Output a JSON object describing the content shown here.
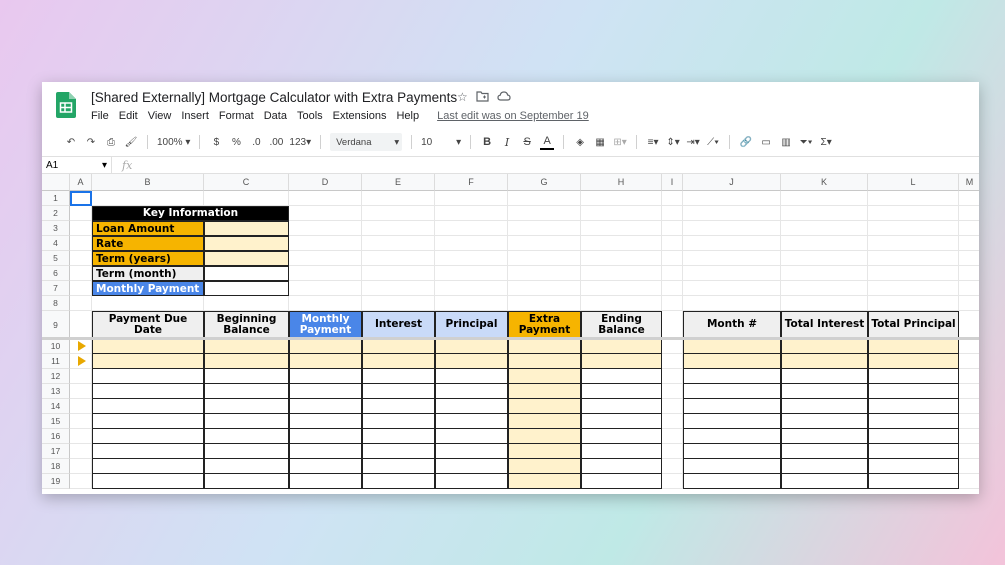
{
  "doc": {
    "title": "[Shared Externally] Mortgage Calculator with Extra Payments",
    "icons": [
      "star-icon",
      "folder-icon",
      "cloud-icon"
    ]
  },
  "menu": [
    "File",
    "Edit",
    "View",
    "Insert",
    "Format",
    "Data",
    "Tools",
    "Extensions",
    "Help"
  ],
  "last_edit": "Last edit was on September 19",
  "toolbar": {
    "zoom": "100%",
    "currency": "$",
    "percent": "%",
    "dec_less": ".0",
    "dec_more": ".00",
    "format_more": "123",
    "font": "Verdana",
    "font_size": "10",
    "bold": "B",
    "italic": "I",
    "strike": "S",
    "text_color": "A",
    "functions": "Σ"
  },
  "formula": {
    "name_box": "A1",
    "fx": "fx"
  },
  "columns": [
    "A",
    "B",
    "C",
    "D",
    "E",
    "F",
    "G",
    "H",
    "I",
    "J",
    "K",
    "L",
    "M"
  ],
  "rows": [
    "1",
    "2",
    "3",
    "4",
    "5",
    "6",
    "7",
    "8",
    "9",
    "10",
    "11",
    "12",
    "13",
    "14",
    "15",
    "16",
    "17",
    "18",
    "19"
  ],
  "key_info": {
    "title": "Key Information",
    "labels": [
      "Loan Amount",
      "Rate",
      "Term (years)",
      "Term (month)",
      "Monthly Payment"
    ]
  },
  "table_headers": [
    "Payment Due Date",
    "Beginning Balance",
    "Monthly Payment",
    "Interest",
    "Principal",
    "Extra Payment",
    "Ending Balance"
  ],
  "summary_headers": [
    "Month #",
    "Total Interest",
    "Total Principal"
  ],
  "colors": {
    "orange": "#f6b400",
    "light_yellow": "#fff2cc",
    "blue": "#4a86e8",
    "light_blue": "#c9daf8",
    "black": "#000000",
    "grey": "#efefef",
    "sheets_green": "#23a566"
  }
}
